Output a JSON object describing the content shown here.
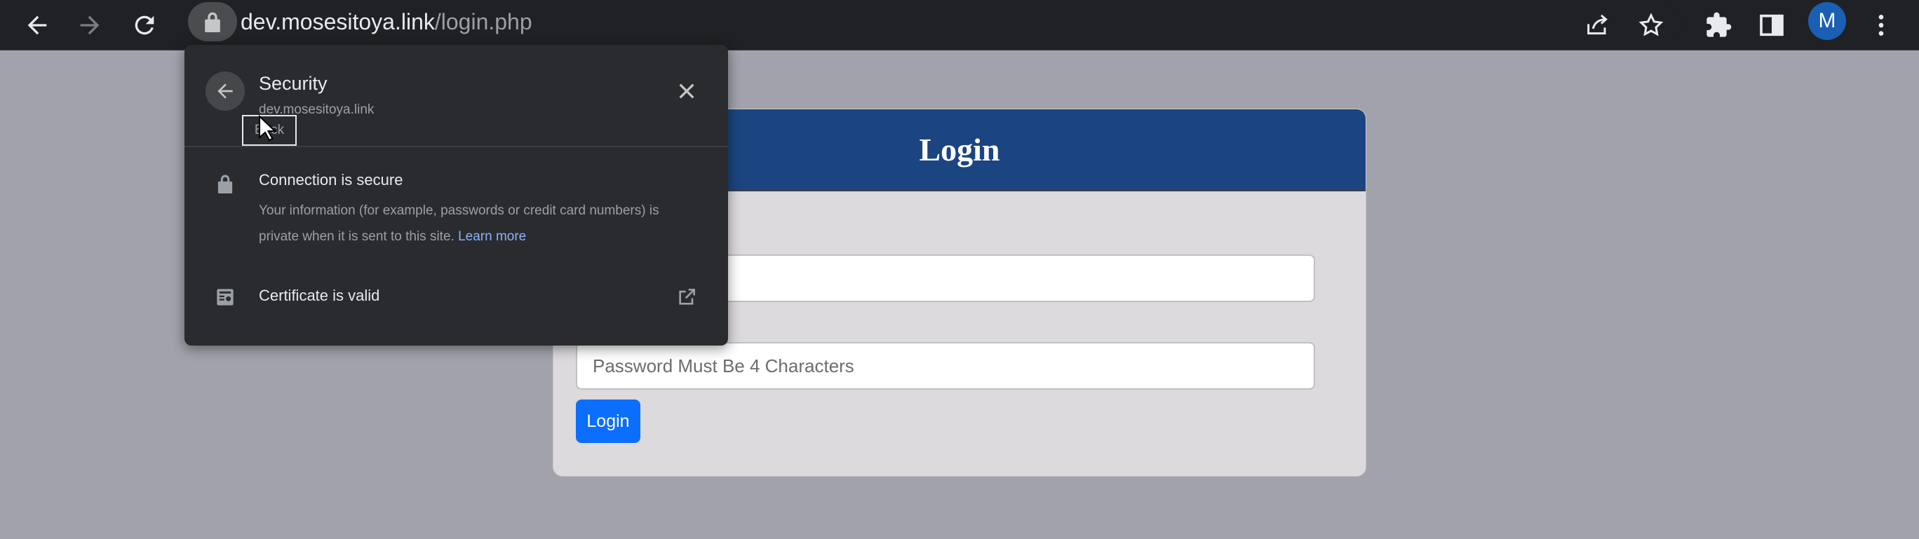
{
  "browser": {
    "url_domain": "dev.mosesitoya.link",
    "url_path": "/login.php",
    "profile_initial": "M",
    "icons": {
      "back": "arrow-left-icon",
      "forward": "arrow-right-icon",
      "reload": "reload-icon",
      "lock": "lock-icon",
      "share": "share-icon",
      "bookmark": "star-icon",
      "extensions": "puzzle-icon",
      "side_panel": "side-panel-icon",
      "menu": "kebab-menu-icon"
    }
  },
  "login_card": {
    "title": "Login",
    "username_placeholder": "",
    "password_placeholder": "Password Must Be 4 Characters",
    "button_label": "Login"
  },
  "security_popup": {
    "title": "Security",
    "subtitle": "dev.mosesitoya.link",
    "back_tooltip": "Back",
    "connection_title": "Connection is secure",
    "connection_desc": "Your information (for example, passwords or credit card numbers) is private when it is sent to this site.",
    "learn_more": "Learn more",
    "certificate_label": "Certificate is valid"
  },
  "colors": {
    "page_bg": "#a2a2ad",
    "toolbar_bg": "#202124",
    "card_header": "#1b4581",
    "card_body": "#dcdadc",
    "primary_button": "#0b6efd",
    "popup_bg": "#2a2b2f",
    "link": "#8ab4f8",
    "avatar": "#1a5fb4"
  }
}
